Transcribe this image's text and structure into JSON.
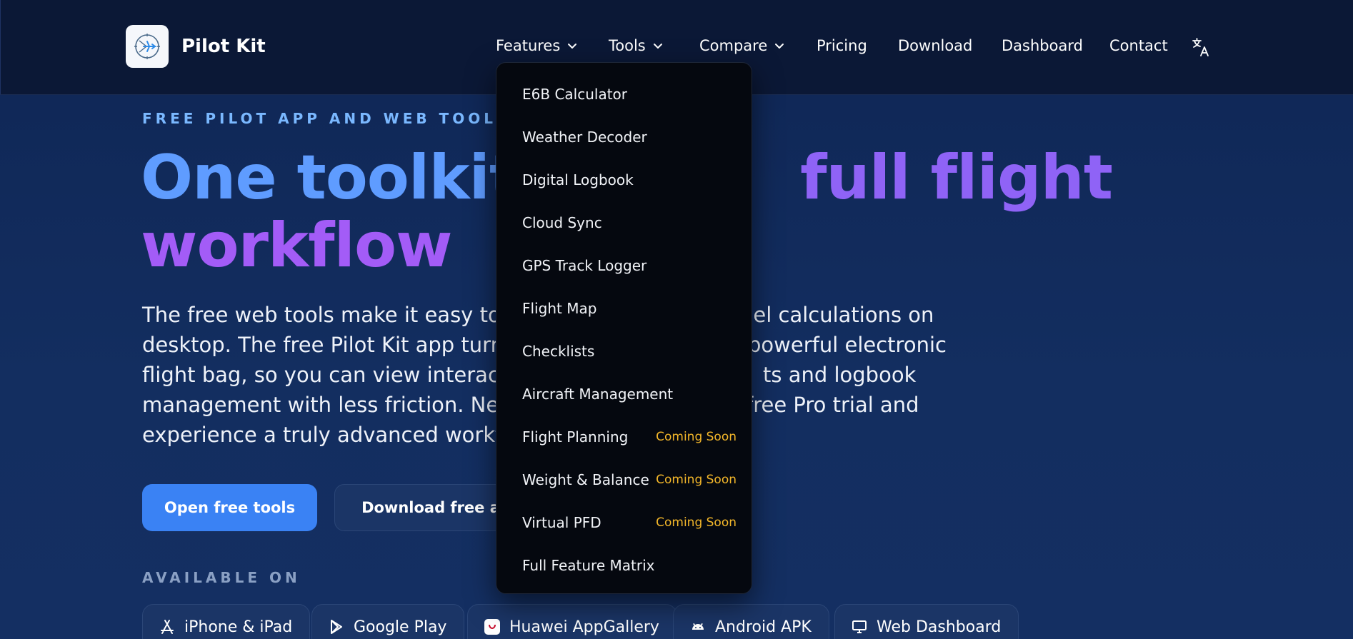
{
  "brand": {
    "name": "Pilot Kit",
    "logo_icon": "compass-plane-icon"
  },
  "nav": {
    "items": [
      {
        "label": "Features",
        "has_dropdown": true
      },
      {
        "label": "Tools",
        "has_dropdown": true
      },
      {
        "label": "Compare",
        "has_dropdown": true
      },
      {
        "label": "Pricing",
        "has_dropdown": false
      },
      {
        "label": "Download",
        "has_dropdown": false
      },
      {
        "label": "Dashboard",
        "has_dropdown": false
      },
      {
        "label": "Contact",
        "has_dropdown": false
      }
    ],
    "language_icon": "translate-icon"
  },
  "dropdown": {
    "open_for": "Features",
    "items": [
      {
        "label": "E6B Calculator",
        "badge": ""
      },
      {
        "label": "Weather Decoder",
        "badge": ""
      },
      {
        "label": "Digital Logbook",
        "badge": ""
      },
      {
        "label": "Cloud Sync",
        "badge": ""
      },
      {
        "label": "GPS Track Logger",
        "badge": ""
      },
      {
        "label": "Flight Map",
        "badge": ""
      },
      {
        "label": "Checklists",
        "badge": ""
      },
      {
        "label": "Aircraft Management",
        "badge": ""
      },
      {
        "label": "Flight Planning",
        "badge": "Coming Soon"
      },
      {
        "label": "Weight & Balance",
        "badge": "Coming Soon"
      },
      {
        "label": "Virtual PFD",
        "badge": "Coming Soon"
      },
      {
        "label": "Full Feature Matrix",
        "badge": ""
      }
    ]
  },
  "hero": {
    "eyebrow": "FREE PILOT APP AND WEB TOOLS",
    "headline_part1": "One toolkit",
    "headline_part2": "full flight",
    "headline_part3": "workflow",
    "copy_lines": [
      "The free web tools make it easy to ha",
      "uel calculations on",
      "desktop. The free Pilot Kit app turns y",
      "powerful electronic",
      "flight bag, so you can view interactive",
      "ts and logbook",
      "management with less friction. Need ",
      "free Pro trial and",
      "experience a truly advanced workflow"
    ],
    "primary_cta": "Open free tools",
    "secondary_cta": "Download free app"
  },
  "available": {
    "heading": "AVAILABLE ON",
    "platforms": [
      {
        "label": "iPhone & iPad",
        "icon": "app-store-icon"
      },
      {
        "label": "Google Play",
        "icon": "google-play-icon"
      },
      {
        "label": "Huawei AppGallery",
        "icon": "huawei-appgallery-icon"
      },
      {
        "label": "Android APK",
        "icon": "android-icon"
      },
      {
        "label": "Web Dashboard",
        "icon": "monitor-icon"
      }
    ]
  },
  "colors": {
    "header_bg": "#0b1836",
    "page_bg": "#132e60",
    "primary": "#3a82f4",
    "gradient_blue": "#5f9cff",
    "gradient_purple": "#a35cf7",
    "badge": "#f5b82a",
    "dropdown_bg": "#05080f"
  }
}
